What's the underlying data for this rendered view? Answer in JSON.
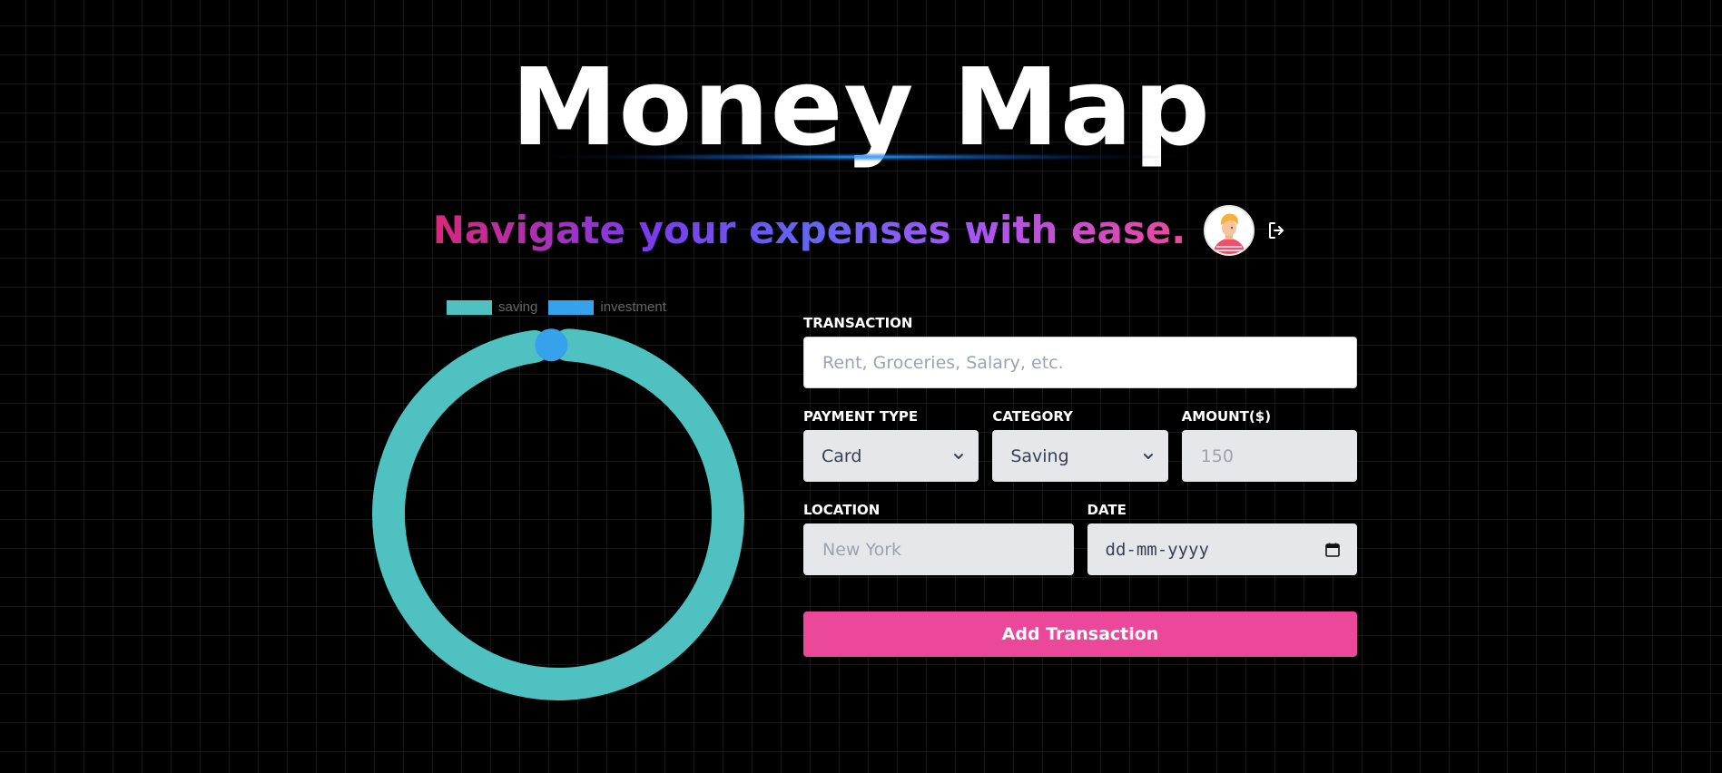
{
  "header": {
    "title": "Money Map",
    "subtitle": "Navigate your expenses with ease."
  },
  "user": {
    "avatar_icon": "avatar-icon",
    "logout_icon": "logout-icon"
  },
  "chart_data": {
    "type": "doughnut",
    "legend": [
      "saving",
      "investment"
    ],
    "series": [
      {
        "name": "saving",
        "value": 300,
        "color": "#4fc1c0"
      },
      {
        "name": "investment",
        "value": 4,
        "color": "#36a2eb"
      }
    ],
    "legend_position": "top"
  },
  "form": {
    "transaction": {
      "label": "Transaction",
      "placeholder": "Rent, Groceries, Salary, etc.",
      "value": ""
    },
    "payment_type": {
      "label": "Payment Type",
      "selected": "Card"
    },
    "category": {
      "label": "Category",
      "selected": "Saving"
    },
    "amount": {
      "label": "Amount($)",
      "placeholder": "150",
      "value": ""
    },
    "location": {
      "label": "Location",
      "placeholder": "New York",
      "value": ""
    },
    "date": {
      "label": "Date",
      "placeholder": "dd-mm-yyyy"
    },
    "submit_label": "Add Transaction"
  },
  "colors": {
    "accent": "#ec4899",
    "saving": "#4fc1c0",
    "investment": "#36a2eb",
    "background": "#000000"
  }
}
